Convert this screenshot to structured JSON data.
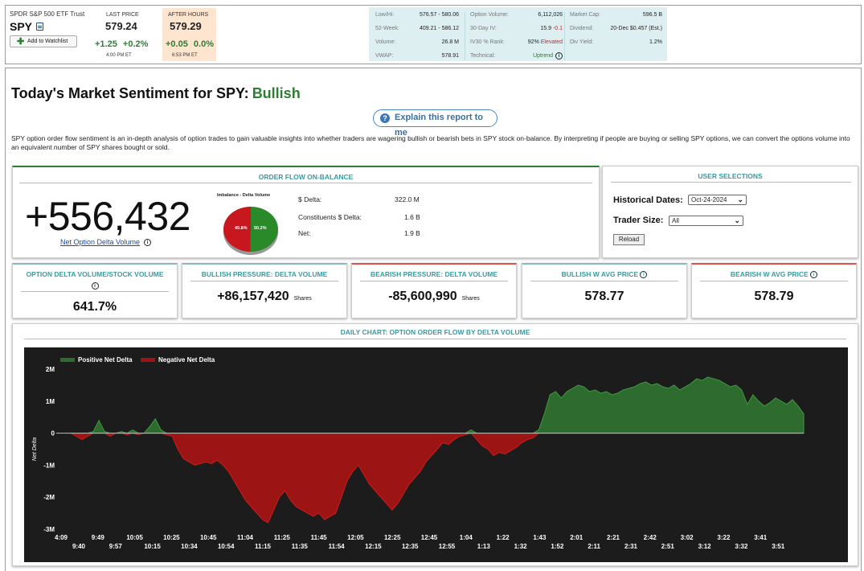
{
  "header": {
    "symbol_name": "SPDR S&P 500 ETF Trust",
    "symbol": "SPY",
    "watchlist_label": "Add to Watchlist",
    "last_price": {
      "label": "LAST PRICE",
      "value": "579.24",
      "change": "+1.25",
      "change_pct": "+0.2%",
      "time": "4:00 PM ET"
    },
    "after_hours": {
      "label": "AFTER HOURS",
      "value": "579.29",
      "change": "+0.05",
      "change_pct": "0.0%",
      "time": "6:53 PM ET"
    },
    "stats_col1": [
      {
        "k": "Low/Hi:",
        "v": "576.57 - 580.06"
      },
      {
        "k": "52-Week:",
        "v": "409.21 - 586.12"
      },
      {
        "k": "Volume:",
        "v": "26.8 M"
      },
      {
        "k": "VWAP:",
        "v": "578.91"
      }
    ],
    "stats_col2": [
      {
        "k": "Option Volume:",
        "v": "6,112,026"
      },
      {
        "k": "30-Day IV:",
        "v": "15.9",
        "v2": "-0.1"
      },
      {
        "k": "IV30 % Rank:",
        "v": "92%",
        "v2": "Elevated"
      },
      {
        "k": "Technical:",
        "v": "Uptrend"
      }
    ],
    "stats_col3": [
      {
        "k": "Market Cap:",
        "v": "596.5 B"
      },
      {
        "k": "Dividend:",
        "v": "20-Dec $0.457 (Est.)"
      },
      {
        "k": "Div Yield:",
        "v": "1.2%"
      }
    ]
  },
  "page": {
    "title": "Today's Market Sentiment for SPY:",
    "sentiment": "Bullish",
    "explain_label": "Explain this report to me",
    "description": "SPY option order flow sentiment is an in-depth analysis of option trades to gain valuable insights into whether traders are wagering bullish or bearish bets in SPY stock on-balance. By interpreting if people are buying or selling SPY options, we can convert the options volume into an equivalent number of SPY shares bought or sold."
  },
  "order_flow": {
    "header": "ORDER FLOW ON-BALANCE",
    "net_value": "+556,432",
    "net_label": "Net Option Delta Volume",
    "pie_title": "Imbalance - Delta Volume",
    "pie_red_pct": 49.8,
    "pie_green_pct": 50.2,
    "pie_red_label": "49.8%",
    "pie_green_label": "50.2%",
    "pie_red_color": "#c8171e",
    "pie_green_color": "#2a8a2a",
    "rows": [
      {
        "k": "$ Delta:",
        "v": "322.0 M"
      },
      {
        "k": "Constituents $ Delta:",
        "v": "1.6 B"
      },
      {
        "k": "Net:",
        "v": "1.9 B"
      }
    ]
  },
  "user_selections": {
    "header": "USER SELECTIONS",
    "hist_label": "Historical Dates:",
    "hist_value": "Oct-24-2024",
    "trader_label": "Trader Size:",
    "trader_value": "All",
    "reload_label": "Reload"
  },
  "metrics": [
    {
      "title": "OPTION DELTA VOLUME/STOCK VOLUME",
      "value": "641.7%",
      "unit": ""
    },
    {
      "title": "BULLISH PRESSURE: DELTA VOLUME",
      "value": "+86,157,420",
      "unit": "Shares"
    },
    {
      "title": "BEARISH PRESSURE: DELTA VOLUME",
      "value": "-85,600,990",
      "unit": "Shares"
    },
    {
      "title": "BULLISH W AVG PRICE",
      "value": "578.77",
      "unit": ""
    },
    {
      "title": "BEARISH W AVG PRICE",
      "value": "578.79",
      "unit": ""
    }
  ],
  "chart_data": {
    "type": "area",
    "title": "DAILY CHART: OPTION ORDER FLOW BY DELTA VOLUME",
    "ylabel": "Net Delta",
    "series": [
      {
        "name": "Positive Net Delta",
        "color": "#2e6b2e"
      },
      {
        "name": "Negative Net Delta",
        "color": "#9c1414"
      }
    ],
    "ylim": [
      -3000000,
      2000000
    ],
    "yticks": [
      {
        "v": 2000000,
        "label": "2M"
      },
      {
        "v": 1000000,
        "label": "1M"
      },
      {
        "v": 0,
        "label": "0"
      },
      {
        "v": -1000000,
        "label": "-1M"
      },
      {
        "v": -2000000,
        "label": "-2M"
      },
      {
        "v": -3000000,
        "label": "-3M"
      }
    ],
    "xticks_top": [
      "4:09",
      "9:49",
      "10:05",
      "10:25",
      "10:45",
      "11:04",
      "11:25",
      "11:45",
      "12:05",
      "12:25",
      "12:45",
      "1:04",
      "1:22",
      "1:43",
      "2:01",
      "2:21",
      "2:42",
      "3:02",
      "3:22",
      "3:41"
    ],
    "xticks_bottom": [
      "9:40",
      "9:57",
      "10:15",
      "10:34",
      "10:54",
      "11:15",
      "11:35",
      "11:54",
      "12:15",
      "12:35",
      "12:55",
      "1:13",
      "1:32",
      "1:52",
      "2:11",
      "2:31",
      "2:51",
      "3:12",
      "3:32",
      "3:51"
    ],
    "values": [
      0,
      -100000,
      -200000,
      -100000,
      50000,
      400000,
      50000,
      -100000,
      0,
      50000,
      -50000,
      100000,
      -50000,
      0,
      200000,
      450000,
      100000,
      -50000,
      -100000,
      -500000,
      -800000,
      -900000,
      -1000000,
      -950000,
      -900000,
      -950000,
      -850000,
      -1000000,
      -1200000,
      -1500000,
      -1800000,
      -2100000,
      -2300000,
      -2500000,
      -2700000,
      -2800000,
      -2400000,
      -2000000,
      -1800000,
      -2100000,
      -2300000,
      -2400000,
      -2500000,
      -2600000,
      -2500000,
      -2700000,
      -2600000,
      -2500000,
      -2000000,
      -1500000,
      -1200000,
      -1000000,
      -1300000,
      -1600000,
      -1800000,
      -2000000,
      -2200000,
      -2400000,
      -2200000,
      -1900000,
      -1600000,
      -1400000,
      -1200000,
      -900000,
      -700000,
      -500000,
      -300000,
      -350000,
      -200000,
      -100000,
      -50000,
      100000,
      -200000,
      -400000,
      -500000,
      -700000,
      -600000,
      -650000,
      -550000,
      -450000,
      -300000,
      -200000,
      -150000,
      100000,
      600000,
      1200000,
      1300000,
      1100000,
      1300000,
      1400000,
      1500000,
      1450000,
      1300000,
      1350000,
      1250000,
      1300000,
      1200000,
      1250000,
      1350000,
      1400000,
      1450000,
      1550000,
      1600000,
      1500000,
      1550000,
      1450000,
      1400000,
      1500000,
      1350000,
      1450000,
      1550000,
      1700000,
      1650000,
      1750000,
      1700000,
      1650000,
      1550000,
      1450000,
      1500000,
      1350000,
      900000,
      1200000,
      1000000,
      850000,
      950000,
      1100000,
      1000000,
      900000,
      1050000,
      850000,
      600000
    ]
  }
}
